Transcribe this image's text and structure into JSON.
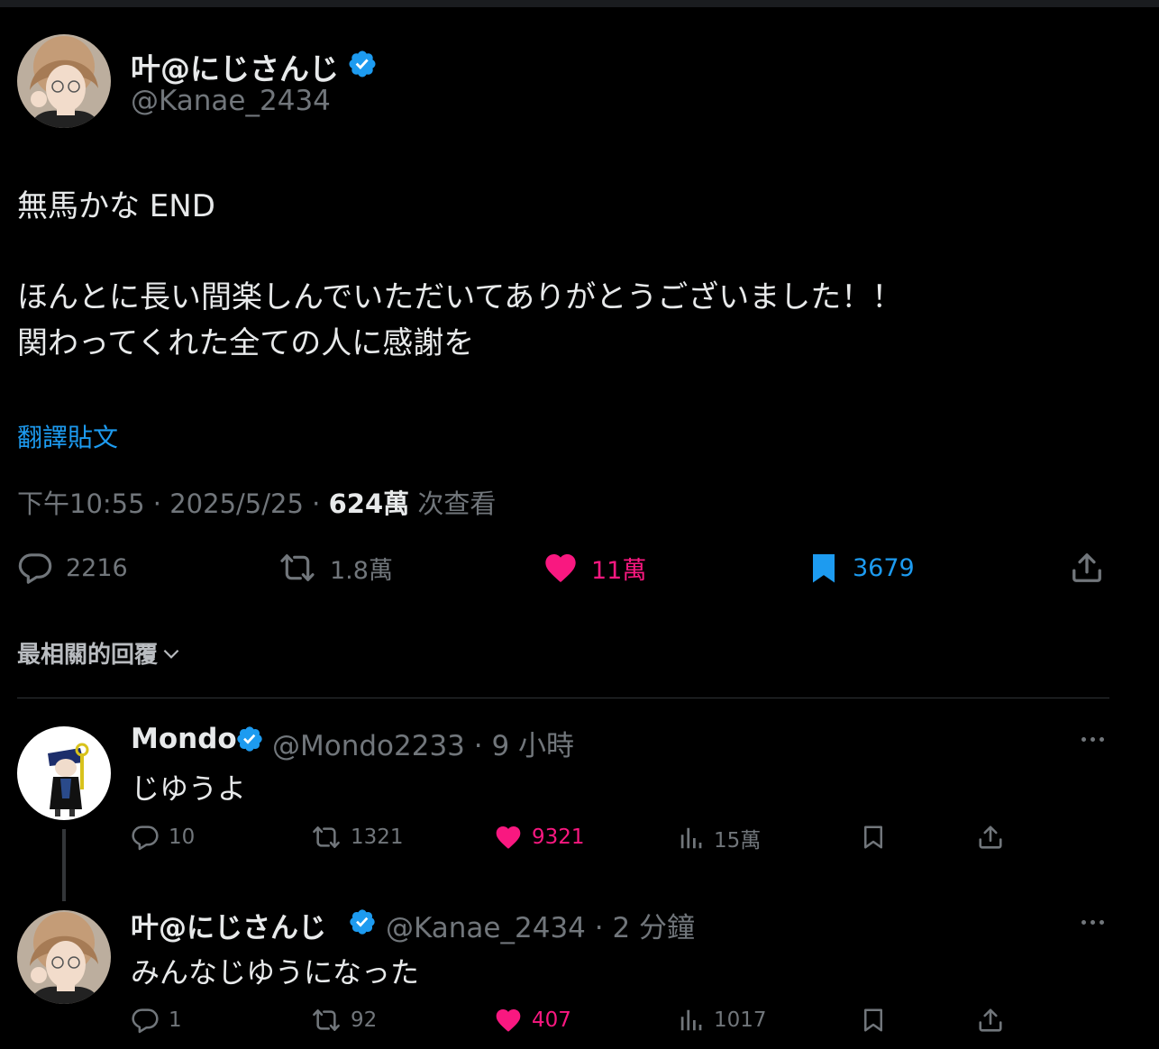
{
  "tweet": {
    "author_name": "叶@にじさんじ",
    "author_handle": "@Kanae_2434",
    "text_line1": "無馬かな END",
    "text_line2": "ほんとに長い間楽しんでいただいてありがとうございました！！",
    "text_line3": "関わってくれた全ての人に感謝を",
    "translate_label": "翻譯貼文",
    "time": "下午10:55",
    "date": "2025/5/25",
    "views_count": "624萬",
    "views_label": "次查看",
    "separator": " · ",
    "stats": {
      "replies": "2216",
      "retweets": "1.8萬",
      "likes": "11萬",
      "bookmarks": "3679"
    }
  },
  "sort_label": "最相關的回覆",
  "replies": [
    {
      "name": "Mondo",
      "handle": "@Mondo2233",
      "time": "9 小時",
      "text": "じゆうよ",
      "stats": {
        "replies": "10",
        "retweets": "1321",
        "likes": "9321",
        "views": "15萬"
      }
    },
    {
      "name": "叶@にじさんじ",
      "handle": "@Kanae_2434",
      "time": "2 分鐘",
      "text": "みんなじゆうになった",
      "stats": {
        "replies": "1",
        "retweets": "92",
        "likes": "407",
        "views": "1017"
      }
    }
  ],
  "colors": {
    "background": "#000000",
    "verified": "#1d9bf0",
    "like": "#f91880",
    "link": "#1d9bf0",
    "muted": "#71767b"
  },
  "icons": [
    "verified-badge-icon",
    "reply-icon",
    "retweet-icon",
    "heart-icon",
    "bookmark-icon",
    "share-icon",
    "views-icon",
    "more-icon",
    "chevron-down-icon"
  ]
}
